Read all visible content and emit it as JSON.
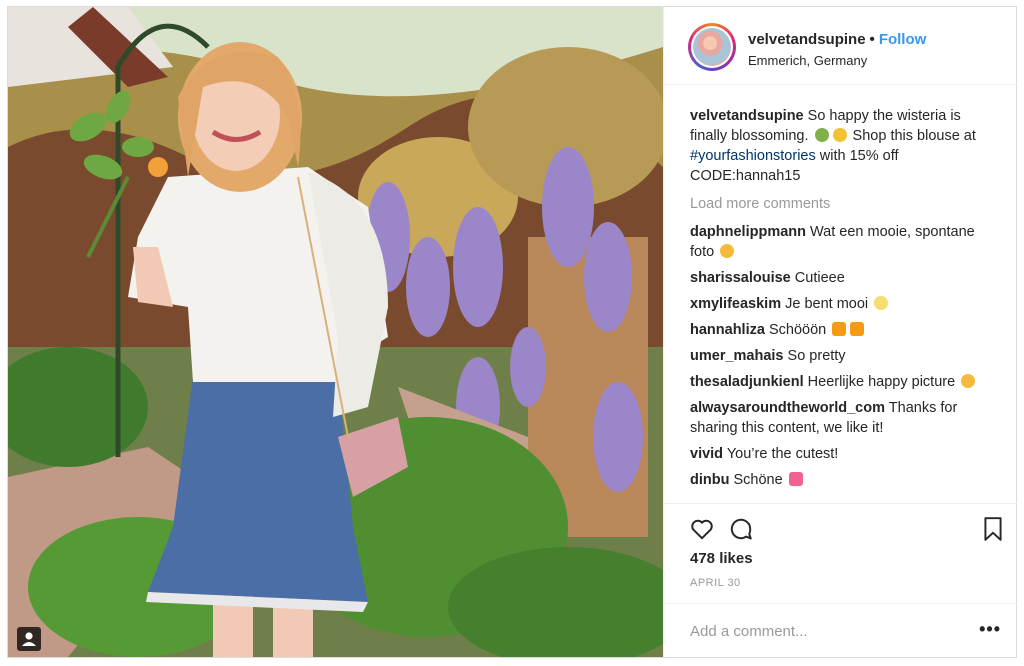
{
  "post": {
    "username": "velvetandsupine",
    "follow_label": "Follow",
    "location": "Emmerich, Germany",
    "caption_text_1": "So happy the wisteria is finally blossoming.",
    "caption_text_2": "Shop this blouse at",
    "hashtag": "#yourfashionstories",
    "caption_text_3": "with 15% off CODE:hannah15",
    "load_more": "Load more comments",
    "likes": "478 likes",
    "date": "APRIL 30"
  },
  "comments": [
    {
      "user": "daphnelippmann",
      "text": "Wat een mooie, spontane foto"
    },
    {
      "user": "sharissalouise",
      "text": "Cutieee"
    },
    {
      "user": "xmylifeaskim",
      "text": "Je bent mooi"
    },
    {
      "user": "hannahliza",
      "text": "Schööön"
    },
    {
      "user": "umer_mahais",
      "text": "So pretty"
    },
    {
      "user": "thesaladjunkienl",
      "text": "Heerlijke happy picture"
    },
    {
      "user": "alwaysaroundtheworld_com",
      "text": "Thanks for sharing this content, we like it!"
    },
    {
      "user": "vivid",
      "text": "You’re the cutest!"
    },
    {
      "user": "dinbu",
      "text": "Schöne"
    }
  ],
  "add_comment": {
    "placeholder": "Add a comment..."
  },
  "icons": {
    "like": "heart-icon",
    "comment": "speech-bubble-icon",
    "save": "bookmark-icon",
    "more": "more-options-icon",
    "tagged": "user-tag-icon"
  },
  "colors": {
    "follow": "#3897f0",
    "hashtag": "#003569",
    "muted": "#999999",
    "text": "#262626"
  }
}
